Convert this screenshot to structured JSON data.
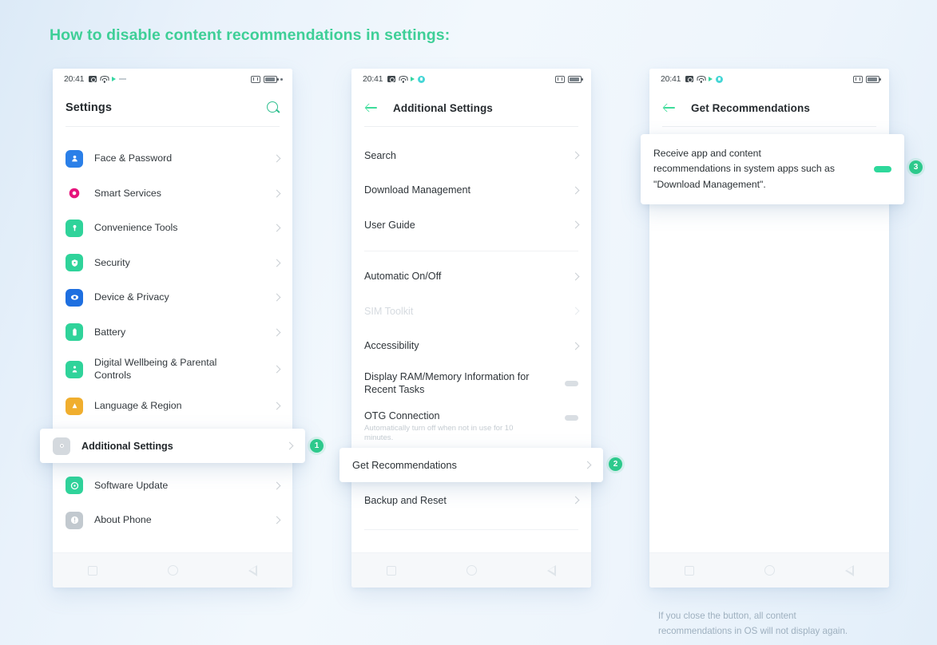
{
  "page": {
    "title": "How to disable content recommendations in settings:",
    "accent_green": "#3ecf97",
    "badge_green": "#2dc98c",
    "background": "#e9f2fb",
    "footer_note_line1": "If you close the button, all content",
    "footer_note_line2": "recommendations in OS will not display again."
  },
  "status_bar": {
    "time": "20:41",
    "left_icons": [
      "camera-icon",
      "wifi-icon",
      "play-icon",
      "dash-icon"
    ],
    "left_icons_2": [
      "camera-icon",
      "wifi-icon",
      "play-icon",
      "shield-icon"
    ],
    "right_icons": [
      "vibrate-icon",
      "battery-icon",
      "dot-icon"
    ]
  },
  "phone1": {
    "header": {
      "title": "Settings",
      "search_icon": "search-icon"
    },
    "items": [
      {
        "label": "Face & Password",
        "icon": "face-password-icon",
        "color": "#2a7fe8"
      },
      {
        "label": "Smart Services",
        "icon": "smart-services-icon",
        "color": "#e6147c"
      },
      {
        "label": "Convenience Tools",
        "icon": "convenience-tools-icon",
        "color": "#2fd39a"
      },
      {
        "label": "Security",
        "icon": "security-icon",
        "color": "#2fd39a"
      },
      {
        "label": "Device & Privacy",
        "icon": "device-privacy-icon",
        "color": "#1e6fe0"
      },
      {
        "label": "Battery",
        "icon": "battery-settings-icon",
        "color": "#2fd39a"
      },
      {
        "label": "Digital Wellbeing & Parental Controls",
        "icon": "digital-wellbeing-icon",
        "color": "#2fd39a"
      },
      {
        "label": "Language & Region",
        "icon": "language-region-icon",
        "color": "#f0ae2e"
      }
    ],
    "highlighted": {
      "label": "Additional Settings",
      "icon": "additional-settings-icon",
      "badge": "1"
    },
    "items_after": [
      {
        "label": "Software Update",
        "icon": "software-update-icon",
        "color": "#2fd39a"
      },
      {
        "label": "About Phone",
        "icon": "about-phone-icon",
        "color": "#b9c0c6"
      }
    ]
  },
  "phone2": {
    "header": {
      "title": "Additional Settings",
      "back_icon": "back-arrow-icon"
    },
    "group1": [
      {
        "label": "Search"
      },
      {
        "label": "Download Management"
      },
      {
        "label": "User Guide"
      }
    ],
    "group2": [
      {
        "label": "Automatic On/Off",
        "dim": false,
        "control": "chevron"
      },
      {
        "label": "SIM Toolkit",
        "dim": true,
        "control": "chevron"
      },
      {
        "label": "Accessibility",
        "dim": false,
        "control": "chevron"
      },
      {
        "label": "Display RAM/Memory Information for Recent Tasks",
        "dim": false,
        "control": "toggle"
      },
      {
        "label": "OTG Connection",
        "sub": "Automatically turn off when not in use for 10 minutes.",
        "dim": false,
        "control": "toggle"
      }
    ],
    "highlighted": {
      "label": "Get Recommendations",
      "badge": "2"
    },
    "group3": [
      {
        "label": "Backup and Reset"
      }
    ]
  },
  "phone3": {
    "header": {
      "title": "Get Recommendations",
      "back_icon": "back-arrow-icon"
    },
    "highlighted": {
      "text": "Receive app and content recommendations in system apps such as \"Download Management\".",
      "toggle_state": "on",
      "toggle_color": "#2ed89b",
      "badge": "3"
    }
  },
  "navbar": {
    "recents_icon": "square-icon",
    "home_icon": "circle-icon",
    "back_icon": "triangle-icon"
  }
}
